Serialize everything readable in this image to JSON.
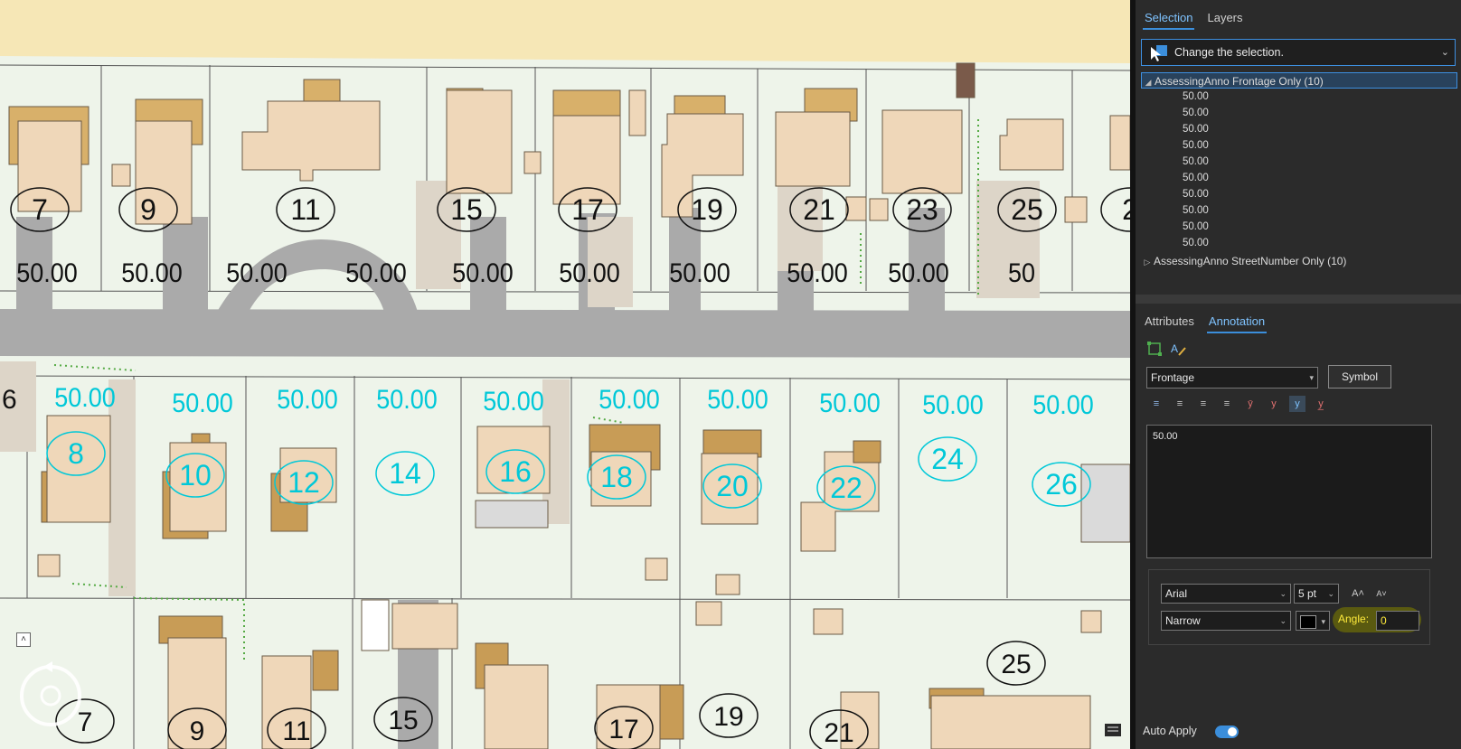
{
  "map": {
    "street_numbers_top": [
      "7",
      "9",
      "11",
      "15",
      "17",
      "19",
      "21",
      "23",
      "25",
      "2"
    ],
    "frontage_top": [
      "50.00",
      "50.00",
      "50.00",
      "50.00",
      "50.00",
      "50.00",
      "50.00",
      "50.00",
      "50.00",
      "50"
    ],
    "street_numbers_middle": [
      "8",
      "10",
      "12",
      "14",
      "16",
      "18",
      "20",
      "22",
      "24",
      "26"
    ],
    "frontage_middle": [
      "50.00",
      "50.00",
      "50.00",
      "50.00",
      "50.00",
      "50.00",
      "50.00",
      "50.00",
      "50.00",
      "50.00"
    ],
    "street_numbers_bottom": [
      "7",
      "9",
      "11",
      "15",
      "17",
      "19",
      "21",
      "25"
    ],
    "edge_number_left": "6",
    "selected_label_color": "#00c8d8",
    "unselected_label_color": "#111111"
  },
  "panel": {
    "tabs_top": [
      "Selection",
      "Layers"
    ],
    "change_selection_label": "Change the selection.",
    "tree": {
      "frontage_layer": "AssessingAnno Frontage Only (10)",
      "frontage_items": [
        "50.00",
        "50.00",
        "50.00",
        "50.00",
        "50.00",
        "50.00",
        "50.00",
        "50.00",
        "50.00",
        "50.00"
      ],
      "streetnumber_layer": "AssessingAnno StreetNumber Only (10)"
    },
    "tabs_bottom": [
      "Attributes",
      "Annotation"
    ],
    "class_combo": "Frontage",
    "symbol_button": "Symbol",
    "annotation_text": "50.00",
    "font_name": "Arial",
    "font_size": "5 pt",
    "font_style": "Narrow",
    "font_color": "#000000",
    "angle_label": "Angle:",
    "angle_value": "0",
    "auto_apply_label": "Auto Apply",
    "accent_color": "#3b8edb"
  }
}
